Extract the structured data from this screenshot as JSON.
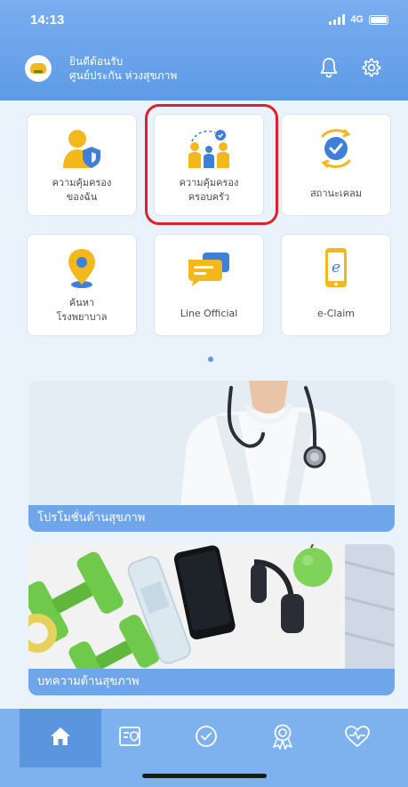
{
  "status_bar": {
    "time": "14:13",
    "network": "4G"
  },
  "header": {
    "welcome_line1": "ยินดีต้อนรับ",
    "welcome_line2": "ศูนย์ประกัน ห่วงสุขภาพ",
    "bell_icon": "bell-icon",
    "settings_icon": "gear-icon"
  },
  "menu": {
    "items": [
      {
        "label_line1": "ความคุ้มครอง",
        "label_line2": "ของฉัน",
        "icon": "person-shield-icon"
      },
      {
        "label_line1": "ความคุ้มครอง",
        "label_line2": "ครอบครัว",
        "icon": "family-icon"
      },
      {
        "label_line1": "สถานะเคลม",
        "label_line2": "",
        "icon": "check-circle-icon"
      },
      {
        "label_line1": "ค้นหา",
        "label_line2": "โรงพยาบาล",
        "icon": "location-pin-icon"
      },
      {
        "label_line1": "Line Official",
        "label_line2": "",
        "icon": "chat-bubble-icon"
      },
      {
        "label_line1": "e-Claim",
        "label_line2": "",
        "icon": "phone-e-icon"
      }
    ],
    "highlighted_index": 1
  },
  "banners": [
    {
      "caption": "โปรโมชั่นด้านสุขภาพ"
    },
    {
      "caption": "บทความด้านสุขภาพ"
    }
  ],
  "bottom_nav": {
    "items": [
      "home-icon",
      "policy-card-icon",
      "check-circle-icon",
      "award-badge-icon",
      "heart-pulse-icon"
    ],
    "active_index": 0
  },
  "colors": {
    "header_blue": "#6ea5ec",
    "highlight_red": "#e0202a",
    "nav_blue": "#7eb2ee",
    "caption_blue": "#6fa6ea"
  }
}
